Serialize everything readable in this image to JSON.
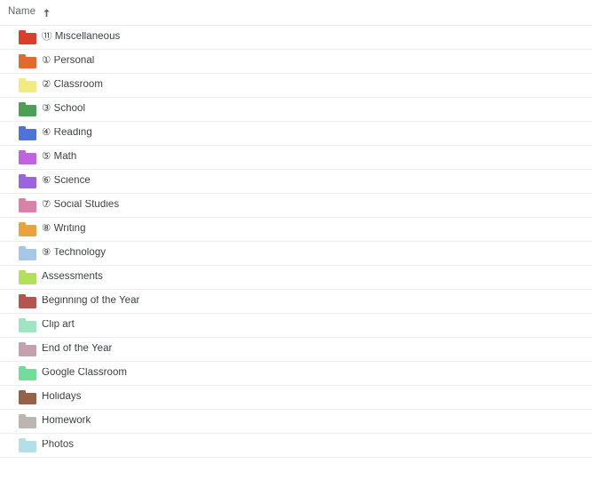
{
  "header": {
    "column_label": "Name",
    "sort_direction": "ascending",
    "sort_icon": "arrow-up-icon"
  },
  "colors": {
    "text": "#3c4043",
    "header_text": "#5f6368",
    "row_divider": "#eceef0",
    "background": "#ffffff"
  },
  "rows": [
    {
      "prefix": "⑪",
      "name": "Miscellaneous",
      "label": "⑪ Miscellaneous",
      "color": "#d93f2b",
      "icon": "folder-icon"
    },
    {
      "prefix": "①",
      "name": "Personal",
      "label": "① Personal",
      "color": "#e2692f",
      "icon": "folder-icon"
    },
    {
      "prefix": "②",
      "name": "Classroom",
      "label": "② Classroom",
      "color": "#f2eb80",
      "icon": "folder-icon"
    },
    {
      "prefix": "③",
      "name": "School",
      "label": "③ School",
      "color": "#4f9e56",
      "icon": "folder-icon"
    },
    {
      "prefix": "④",
      "name": "Reading",
      "label": "④ Reading",
      "color": "#5073db",
      "icon": "folder-icon"
    },
    {
      "prefix": "⑤",
      "name": "Math",
      "label": "⑤ Math",
      "color": "#c163e0",
      "icon": "folder-icon"
    },
    {
      "prefix": "⑥",
      "name": "Science",
      "label": "⑥ Science",
      "color": "#9b63de",
      "icon": "folder-icon"
    },
    {
      "prefix": "⑦",
      "name": "Social Studies",
      "label": "⑦ Social Studies",
      "color": "#dd80a8",
      "icon": "folder-icon"
    },
    {
      "prefix": "⑧",
      "name": "Writing",
      "label": "⑧ Writing",
      "color": "#e8a33d",
      "icon": "folder-icon"
    },
    {
      "prefix": "⑨",
      "name": "Technology",
      "label": "⑨ Technology",
      "color": "#a8c7e8",
      "icon": "folder-icon"
    },
    {
      "prefix": "",
      "name": "Assessments",
      "label": "Assessments",
      "color": "#b2e05e",
      "icon": "folder-icon"
    },
    {
      "prefix": "",
      "name": "Beginning of the Year",
      "label": "Beginning of the Year",
      "color": "#b3564f",
      "icon": "folder-icon"
    },
    {
      "prefix": "",
      "name": "Clip art",
      "label": "Clip art",
      "color": "#9fe5bf",
      "icon": "folder-icon"
    },
    {
      "prefix": "",
      "name": "End of the Year",
      "label": "End of the Year",
      "color": "#c4a1ac",
      "icon": "folder-icon"
    },
    {
      "prefix": "",
      "name": "Google Classroom",
      "label": "Google Classroom",
      "color": "#70dd9a",
      "icon": "folder-icon"
    },
    {
      "prefix": "",
      "name": "Holidays",
      "label": "Holidays",
      "color": "#96614b",
      "icon": "folder-icon"
    },
    {
      "prefix": "",
      "name": "Homework",
      "label": "Homework",
      "color": "#bdb5b2",
      "icon": "folder-icon"
    },
    {
      "prefix": "",
      "name": "Photos",
      "label": "Photos",
      "color": "#b4dfe8",
      "icon": "folder-icon"
    }
  ]
}
